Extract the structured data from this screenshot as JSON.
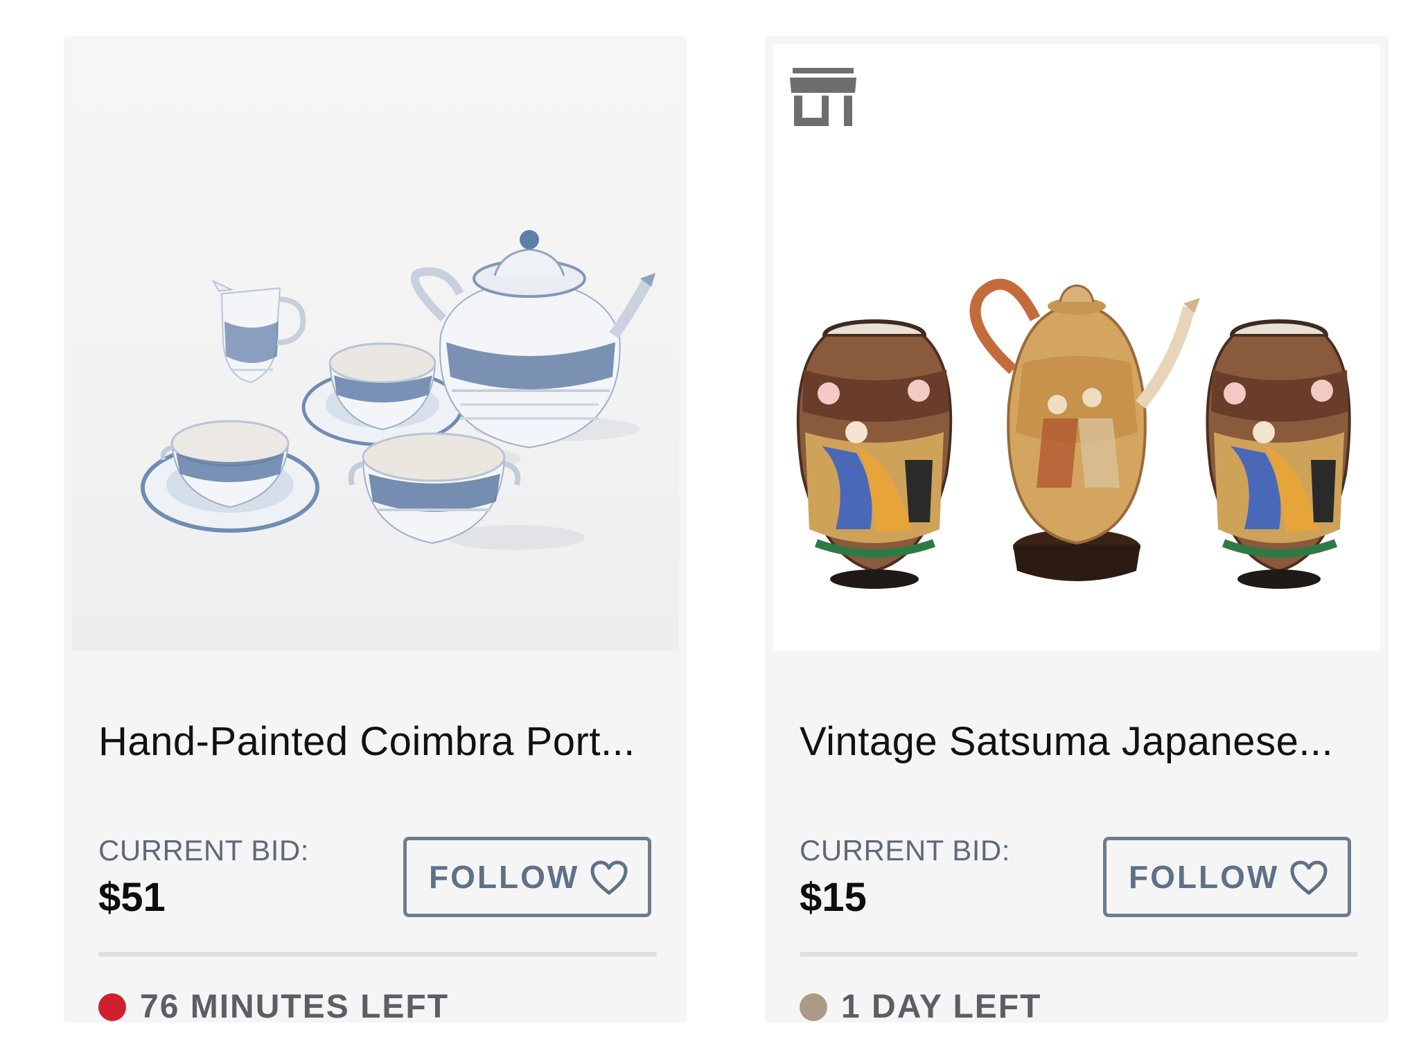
{
  "listings": [
    {
      "image_alt": "hand-painted blue and white porcelain tea set",
      "title": "Hand-Painted Coimbra Port...",
      "bid_label": "CURRENT BID:",
      "bid_value": "$51",
      "follow_label": "FOLLOW",
      "time_left": "76 MINUTES LEFT",
      "status_color": "#d0202e",
      "store_badge": false
    },
    {
      "image_alt": "vintage Satsuma Japanese vases and teapot",
      "title": "Vintage Satsuma Japanese...",
      "bid_label": "CURRENT BID:",
      "bid_value": "$15",
      "follow_label": "FOLLOW",
      "time_left": "1 DAY LEFT",
      "status_color": "#ab9b86",
      "store_badge": true,
      "store_badge_icon": "storefront-icon"
    }
  ],
  "colors": {
    "card_background": "#f5f5f6",
    "follow_border": "#6c7d8e",
    "follow_text": "#5e7186",
    "divider": "#dddfe2"
  }
}
